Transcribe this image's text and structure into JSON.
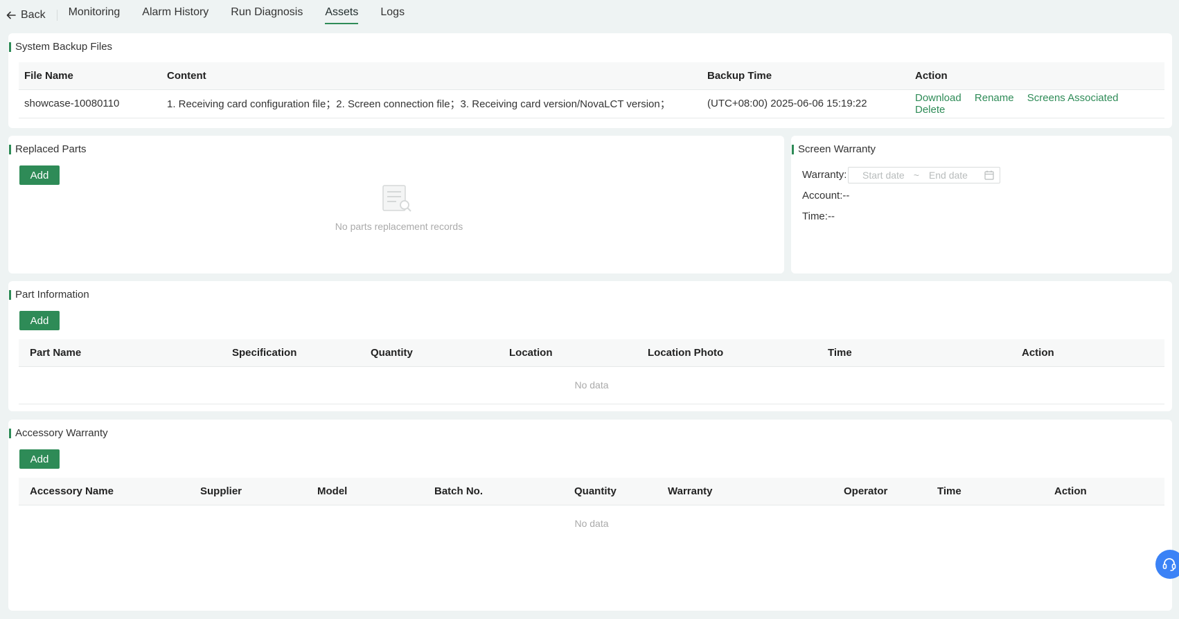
{
  "nav": {
    "back_label": "Back",
    "tabs": [
      "Monitoring",
      "Alarm History",
      "Run Diagnosis",
      "Assets",
      "Logs"
    ],
    "active_tab": "Assets"
  },
  "backup": {
    "title": "System Backup Files",
    "columns": [
      "File Name",
      "Content",
      "Backup Time",
      "Action"
    ],
    "rows": [
      {
        "file_name": "showcase-10080110",
        "content": "1. Receiving card configuration file；2. Screen connection file；3. Receiving card version/NovaLCT version；",
        "backup_time": "(UTC+08:00) 2025-06-06 15:19:22",
        "actions": [
          "Download",
          "Rename",
          "Screens Associated",
          "Delete"
        ]
      }
    ]
  },
  "replaced": {
    "title": "Replaced Parts",
    "add_label": "Add",
    "empty_text": "No parts replacement records"
  },
  "warranty": {
    "title": "Screen Warranty",
    "warranty_label": "Warranty:",
    "start_placeholder": "Start date",
    "separator": "~",
    "end_placeholder": "End date",
    "account_label": "Account:--",
    "time_label": "Time:--"
  },
  "parts": {
    "title": "Part Information",
    "add_label": "Add",
    "columns": [
      "Part Name",
      "Specification",
      "Quantity",
      "Location",
      "Location Photo",
      "Time",
      "Action"
    ],
    "empty_text": "No data"
  },
  "accessory": {
    "title": "Accessory Warranty",
    "add_label": "Add",
    "columns": [
      "Accessory Name",
      "Supplier",
      "Model",
      "Batch No.",
      "Quantity",
      "Warranty",
      "Operator",
      "Time",
      "Action"
    ],
    "empty_text": "No data"
  },
  "colors": {
    "accent": "#2e8b57",
    "background": "#eef3f3",
    "support_button": "#3b82f6"
  },
  "icons": [
    "arrow-left-icon",
    "empty-document-search-icon",
    "calendar-icon",
    "headset-icon"
  ]
}
